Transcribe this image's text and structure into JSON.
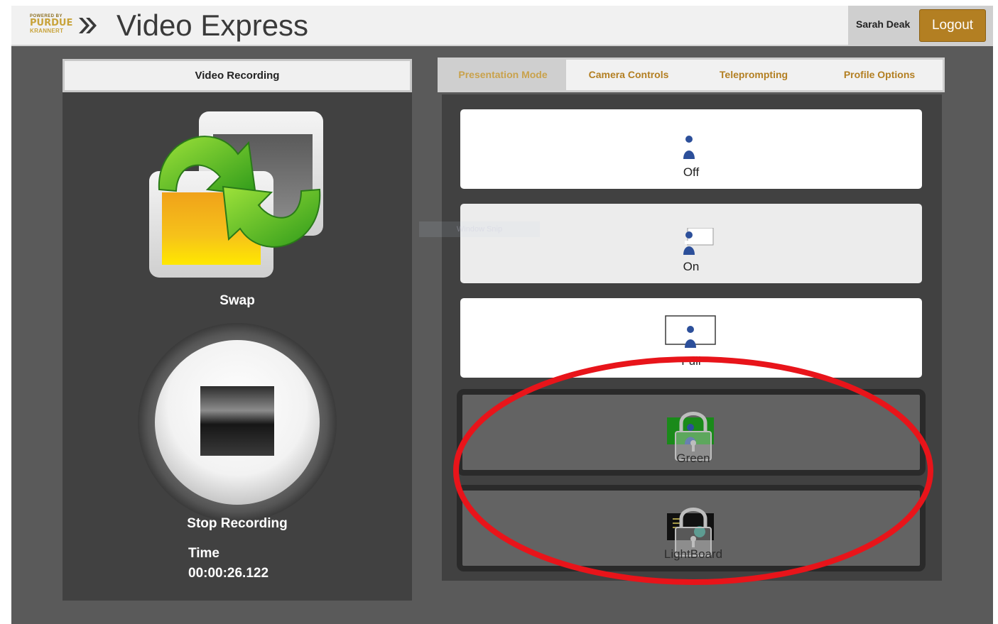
{
  "header": {
    "logo": {
      "powered_by": "POWERED BY",
      "purdue": "PURDUE",
      "krannert": "KRANNERT"
    },
    "title": "Video Express",
    "user_name": "Sarah Deak",
    "logout_label": "Logout"
  },
  "left_panel": {
    "tab_label": "Video Recording",
    "swap_label": "Swap",
    "stop_label": "Stop Recording",
    "time_label": "Time",
    "time_value": "00:00:26.122"
  },
  "tabs": [
    {
      "label": "Presentation Mode",
      "active": true
    },
    {
      "label": "Camera Controls",
      "active": false
    },
    {
      "label": "Teleprompting",
      "active": false
    },
    {
      "label": "Profile Options",
      "active": false
    }
  ],
  "modes": [
    {
      "label": "Off",
      "icon": "person-icon",
      "locked": false
    },
    {
      "label": "On",
      "icon": "person-with-window-icon",
      "locked": false
    },
    {
      "label": "Full",
      "icon": "person-full-frame-icon",
      "locked": false
    },
    {
      "label": "Green",
      "icon": "green-screen-icon",
      "locked": true
    },
    {
      "label": "LightBoard",
      "icon": "lightboard-icon",
      "locked": true
    }
  ],
  "watermark_text": "Window Snip",
  "colors": {
    "accent": "#b37f22",
    "background": "#5a5a5a",
    "panel": "#414141",
    "annotation": "#e8141a"
  }
}
